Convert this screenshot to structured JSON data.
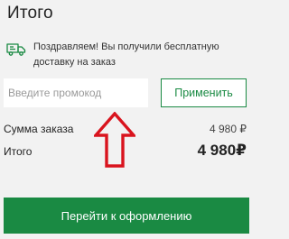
{
  "summary": {
    "title": "Итого",
    "shipping_notice": "Поздравляем! Вы получили бесплатную доставку на заказ",
    "shipping_icon": "delivery-truck-icon",
    "accent_color": "#1a8a43",
    "arrow_color": "#d9141e"
  },
  "promo": {
    "placeholder": "Введите промокод",
    "value": "",
    "apply_label": "Применить"
  },
  "totals": {
    "order_sum_label": "Сумма заказа",
    "order_sum_value": "4 980 ₽",
    "total_label": "Итого",
    "total_value": "4 980₽"
  },
  "checkout": {
    "label": "Перейти к оформлению"
  }
}
